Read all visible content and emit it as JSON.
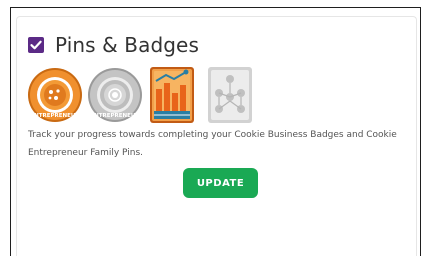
{
  "card": {
    "title": "Pins & Badges",
    "description": "Track your progress towards completing your Cookie Business Badges and Cookie Entrepreneur Family Pins.",
    "update_label": "UPDATE"
  },
  "badges": [
    {
      "name": "cookie-entrepreneur-gold-pin",
      "text": "ENTREPRENEUR",
      "status": "earned"
    },
    {
      "name": "cookie-entrepreneur-silver-pin",
      "text": "ENTREPRENEUR",
      "status": "earned"
    },
    {
      "name": "cookie-business-chart-badge",
      "status": "earned"
    },
    {
      "name": "cookie-business-network-badge",
      "status": "locked"
    }
  ],
  "colors": {
    "accent_purple": "#5b2a86",
    "button_green": "#1aa954",
    "gold": "#e8862c",
    "silver": "#b9b9b9",
    "locked_gray": "#cfcfcf"
  }
}
